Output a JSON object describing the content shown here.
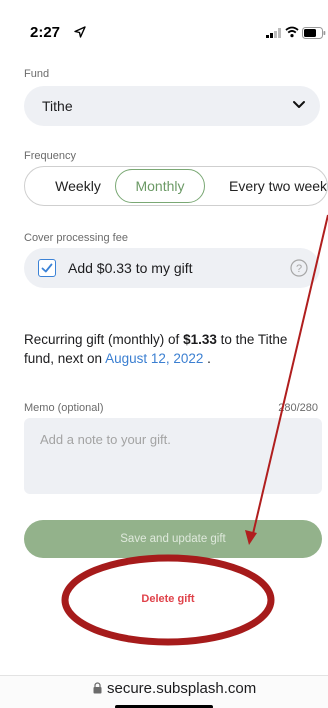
{
  "status_bar": {
    "time": "2:27"
  },
  "fund": {
    "label": "Fund",
    "value": "Tithe"
  },
  "frequency": {
    "label": "Frequency",
    "options": [
      "Weekly",
      "Monthly",
      "Every two week"
    ],
    "selected": "Monthly"
  },
  "fee": {
    "label": "Cover processing fee",
    "checked": true,
    "text": "Add $0.33 to my gift"
  },
  "summary": {
    "prefix": "Recurring gift (monthly) of ",
    "amount": "$1.33",
    "middle": " to the Tithe fund, next on ",
    "date": "August 12, 2022",
    "suffix": " ."
  },
  "memo": {
    "label": "Memo (optional)",
    "count": "280/280",
    "placeholder": "Add a note to your gift."
  },
  "buttons": {
    "save": "Save and update gift",
    "delete": "Delete gift"
  },
  "browser": {
    "url": "secure.subsplash.com"
  },
  "colors": {
    "accent_green": "#6c9a66",
    "save_button": "#93b28b",
    "delete_red": "#e0424a",
    "link_blue": "#3b7fd1",
    "annotation_red": "#b01e1e"
  }
}
